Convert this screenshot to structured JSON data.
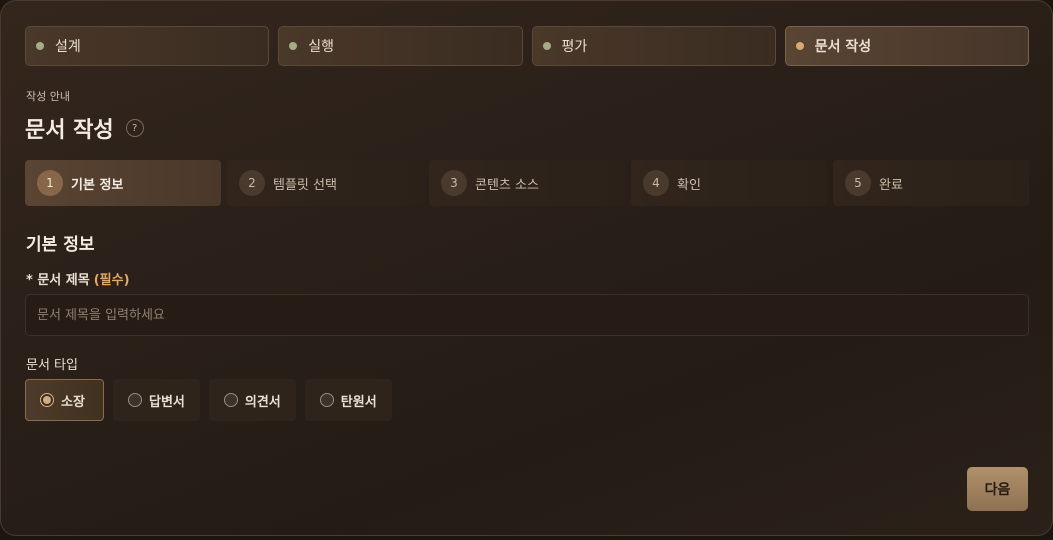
{
  "top_tabs": [
    {
      "label": "설계",
      "active": false
    },
    {
      "label": "실행",
      "active": false
    },
    {
      "label": "평가",
      "active": false
    },
    {
      "label": "문서 작성",
      "active": true
    }
  ],
  "header": {
    "eyebrow": "작성 안내",
    "title": "문서 작성",
    "help_glyph": "?"
  },
  "steps": [
    {
      "num": "1",
      "label": "기본 정보",
      "active": true
    },
    {
      "num": "2",
      "label": "템플릿 선택",
      "active": false
    },
    {
      "num": "3",
      "label": "콘텐츠 소스",
      "active": false
    },
    {
      "num": "4",
      "label": "확인",
      "active": false
    },
    {
      "num": "5",
      "label": "완료",
      "active": false
    }
  ],
  "form": {
    "section_title": "기본 정보",
    "title_field": {
      "label": "* 문서 제목",
      "required_note": "(필수)",
      "value": "",
      "placeholder": "문서 제목을 입력하세요"
    },
    "type_field": {
      "label": "문서 타입",
      "options": [
        {
          "label": "소장",
          "selected": true
        },
        {
          "label": "답변서",
          "selected": false
        },
        {
          "label": "의견서",
          "selected": false
        },
        {
          "label": "탄원서",
          "selected": false
        }
      ]
    }
  },
  "actions": {
    "next_label": "다음"
  },
  "colors": {
    "accent": "#d6a96c",
    "dot_inactive": "#a6ad86",
    "required": "#e0aa66",
    "button": "#a3845f"
  }
}
